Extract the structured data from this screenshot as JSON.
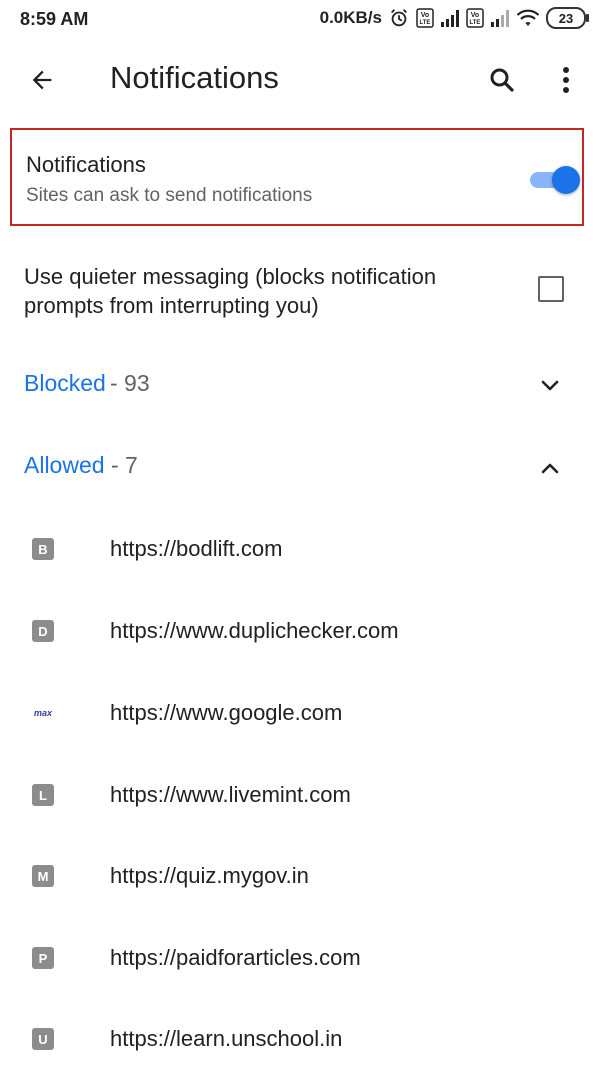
{
  "status_bar": {
    "time": "8:59 AM",
    "speed": "0.0KB/s",
    "battery": "23",
    "icons": [
      "alarm-icon",
      "volte-icon",
      "signal-icon",
      "volte-icon",
      "signal-icon",
      "wifi-icon",
      "battery-icon"
    ]
  },
  "toolbar": {
    "title": "Notifications",
    "back_icon": "back-arrow-icon",
    "search_icon": "search-icon",
    "more_icon": "more-vert-icon"
  },
  "notifications_setting": {
    "title": "Notifications",
    "subtitle": "Sites can ask to send notifications",
    "enabled": true,
    "highlight_color": "#c62828",
    "toggle_color": "#1a73e8"
  },
  "quiet_messaging": {
    "label": "Use quieter messaging (blocks notification prompts from interrupting you)",
    "checked": false
  },
  "blocked": {
    "label": "Blocked",
    "count": " - 93",
    "expanded": false
  },
  "allowed": {
    "label": "Allowed",
    "count": " - 7",
    "expanded": true
  },
  "sites": [
    {
      "letter": "B",
      "url": "https://bodlift.com"
    },
    {
      "letter": "D",
      "url": "https://www.duplichecker.com"
    },
    {
      "letter": "max",
      "url": "https://www.google.com"
    },
    {
      "letter": "L",
      "url": "https://www.livemint.com"
    },
    {
      "letter": "M",
      "url": "https://quiz.mygov.in"
    },
    {
      "letter": "P",
      "url": "https://paidforarticles.com"
    },
    {
      "letter": "U",
      "url": "https://learn.unschool.in"
    }
  ],
  "colors": {
    "link_blue": "#1a73e8",
    "secondary_text": "#5f6368",
    "favicon_gray": "#8c8c8c"
  }
}
